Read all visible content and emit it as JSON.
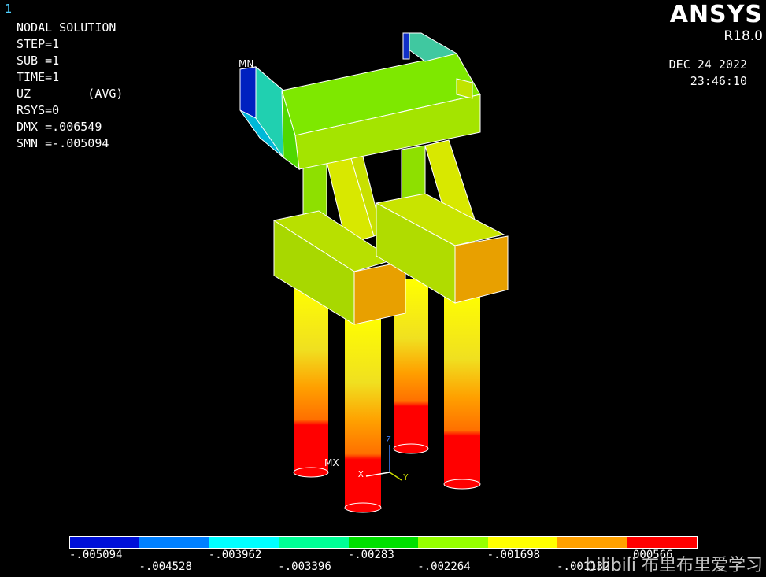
{
  "window_number": "1",
  "info": {
    "lines": [
      "NODAL SOLUTION",
      "",
      "STEP=1",
      "SUB =1",
      "TIME=1",
      "UZ        (AVG)",
      "RSYS=0",
      "DMX =.006549",
      "SMN =-.005094"
    ]
  },
  "brand": {
    "logo": "ANSYS",
    "release": "R18.0"
  },
  "timestamp": {
    "date": "DEC 24 2022",
    "time": "23:46:10"
  },
  "labels": {
    "min_marker": "MN",
    "max_marker": "MX"
  },
  "axes": {
    "z": "Z",
    "x": "X",
    "y": "Y"
  },
  "legend": {
    "colors": [
      "#0010d8",
      "#0080ff",
      "#00ffff",
      "#00ff96",
      "#00e000",
      "#96ff00",
      "#ffff00",
      "#ffa000",
      "#ff0000"
    ],
    "labels_top": [
      "-.005094",
      "-.003962",
      "-.00283",
      "-.001698",
      ".000566"
    ],
    "labels_bottom": [
      "-.004528",
      "-.003396",
      "-.002264",
      "-.001132"
    ]
  },
  "watermark": "bilibili 布里布里爱学习"
}
